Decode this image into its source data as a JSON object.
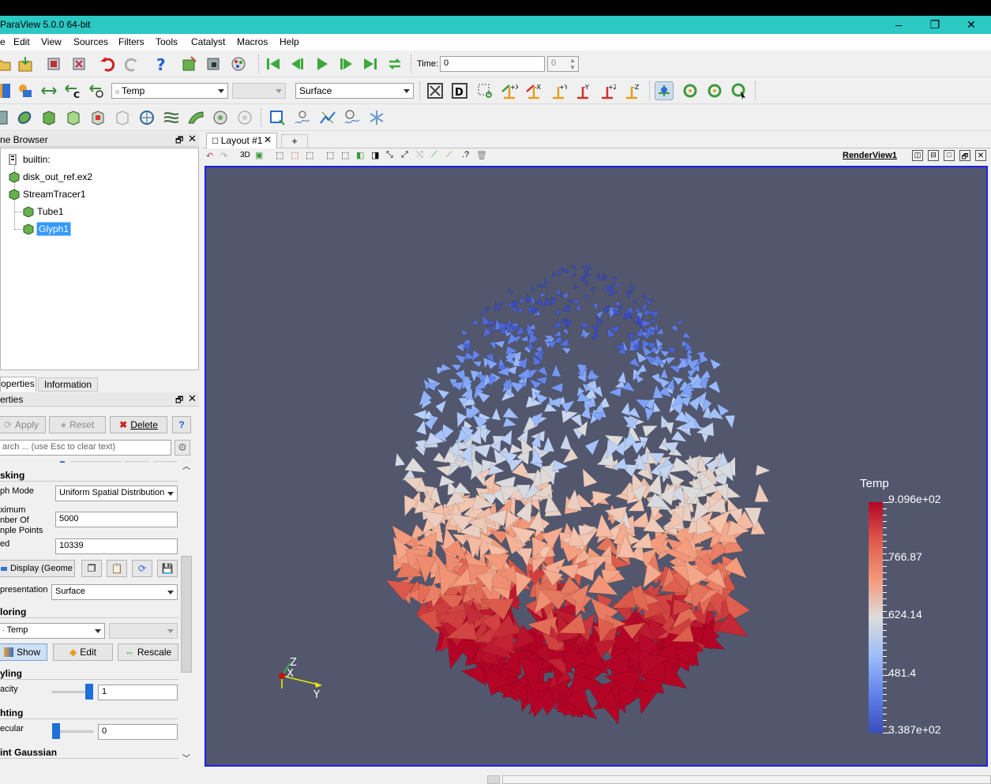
{
  "window": {
    "title": "ParaView 5.0.0 64-bit",
    "controls": [
      "–",
      "❐",
      "✕"
    ]
  },
  "menu": [
    "Edit",
    "View",
    "Sources",
    "Filters",
    "Tools",
    "Catalyst",
    "Macros",
    "Help"
  ],
  "time": {
    "label": "Time:",
    "value": "0",
    "step": "0"
  },
  "toolbar2": {
    "color_array": "Temp",
    "component": "",
    "representation": "Surface"
  },
  "pipeline": {
    "header": "ne Browser",
    "items": [
      "builtin:",
      "disk_out_ref.ex2",
      "StreamTracer1",
      "Tube1",
      "Glyph1"
    ]
  },
  "tabs": {
    "properties": "operties",
    "information": "Information"
  },
  "properties": {
    "header": "erties",
    "apply": "Apply",
    "reset": "Reset",
    "delete": "Delete",
    "help": "?",
    "search_placeholder": "arch ... (use Esc to clear text)",
    "masking": "sking",
    "glyph_mode_label": "ph Mode",
    "glyph_mode_value": "Uniform Spatial Distribution",
    "max_points_label_1": "ximum",
    "max_points_label_2": "nber Of",
    "max_points_label_3": "nple Points",
    "max_points_value": "5000",
    "seed_label": "ed",
    "seed_value": "10339",
    "display_label": "Display (Geome",
    "representation_label": "presentation",
    "representation_value": "Surface",
    "coloring": "loring",
    "color_value": "Temp",
    "show": "Show",
    "edit": "Edit",
    "rescale": "Rescale",
    "styling": "yling",
    "opacity_label": "acity",
    "opacity_value": "1",
    "opacity_level": 1.0,
    "lighting": "hting",
    "specular_label": "ecular",
    "specular_value": "0",
    "specular_level": 0.0,
    "gaussian": "int Gaussian"
  },
  "layout": {
    "tab": "Layout #1",
    "add": "+",
    "view3d": "3D",
    "render_view": "RenderView1"
  },
  "legend": {
    "title": "Temp",
    "labels": [
      "9.096e+02",
      "766.87",
      "624.14",
      "481.4",
      "3.387e+02"
    ]
  },
  "axes": {
    "x": "X",
    "y": "Y",
    "z": "Z"
  },
  "colors": {
    "titlebar": "#2bc8c4",
    "background": "#52576e",
    "selection": "#3399ff"
  }
}
